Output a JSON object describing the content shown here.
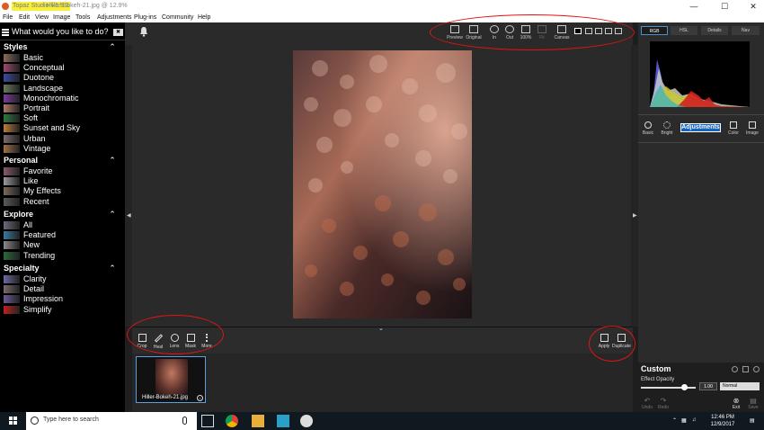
{
  "window": {
    "title_highlight": "Topaz Studio V1.5.3",
    "title_rest": "- Hiller-Bokeh-21.jpg @ 12.9%",
    "minimize": "—",
    "maximize": "☐",
    "close": "✕"
  },
  "menu": [
    "File",
    "Edit",
    "View",
    "Image",
    "Tools",
    "Adjustments",
    "Plug-ins",
    "Community",
    "Help"
  ],
  "sidebar": {
    "search_placeholder": "What would you like to do?",
    "clear_label": "✖",
    "collapse_glyph": "⌃",
    "sections": [
      {
        "title": "Styles",
        "items": [
          {
            "label": "Basic",
            "color": "#8a6a5a"
          },
          {
            "label": "Conceptual",
            "color": "#9a4a6a"
          },
          {
            "label": "Duotone",
            "color": "#3a4aa0"
          },
          {
            "label": "Landscape",
            "color": "#6a7a5a"
          },
          {
            "label": "Monochromatic",
            "color": "#7a3aa0"
          },
          {
            "label": "Portrait",
            "color": "#b07a6a"
          },
          {
            "label": "Soft",
            "color": "#2a7a3a"
          },
          {
            "label": "Sunset and Sky",
            "color": "#c07a3a"
          },
          {
            "label": "Urban",
            "color": "#7a6a6a"
          },
          {
            "label": "Vintage",
            "color": "#a0704a"
          }
        ]
      },
      {
        "title": "Personal",
        "items": [
          {
            "label": "Favorite",
            "color": "#8a5a6a"
          },
          {
            "label": "Like",
            "color": "#9a9aa0"
          },
          {
            "label": "My Effects",
            "color": "#7a6a5a"
          },
          {
            "label": "Recent",
            "color": "#5a5a5a"
          }
        ]
      },
      {
        "title": "Explore",
        "items": [
          {
            "label": "All",
            "color": "#6a6a7a"
          },
          {
            "label": "Featured",
            "color": "#3a7aa0"
          },
          {
            "label": "New",
            "color": "#8a8a8a"
          },
          {
            "label": "Trending",
            "color": "#2a6a3a"
          }
        ]
      },
      {
        "title": "Specialty",
        "items": [
          {
            "label": "Clarity",
            "color": "#6a6aa0"
          },
          {
            "label": "Detail",
            "color": "#7a6a6a"
          },
          {
            "label": "Impression",
            "color": "#6a5a9a"
          },
          {
            "label": "Simplify",
            "color": "#c02020"
          }
        ]
      }
    ]
  },
  "toolbar": {
    "buttons": [
      "Preview",
      "Original",
      "In",
      "Out",
      "100%",
      "Fit",
      "Canvas"
    ]
  },
  "bottom_tools": {
    "left": [
      "Crop",
      "Heal",
      "Lens",
      "Mask",
      "More"
    ],
    "right": [
      "Apply",
      "Duplicate"
    ]
  },
  "filmstrip": {
    "file_name": "Hiller-Bokeh-21.jpg"
  },
  "right_panel": {
    "tabs": [
      "RGB",
      "HSL",
      "Details",
      "Nav"
    ],
    "tools": [
      "Basic",
      "Bright",
      "Adjustments",
      "Color",
      "Image"
    ],
    "custom_title": "Custom",
    "opacity_label": "Effect Opacity",
    "opacity_value": "1.00",
    "blend_mode": "Normal",
    "footer": [
      "Undo",
      "Redo",
      "Exit",
      "Save"
    ]
  },
  "taskbar": {
    "search_placeholder": "Type here to search",
    "time": "12:46 PM",
    "date": "12/9/2017"
  },
  "colors": {
    "annotation": "#e01515",
    "title_highlight": "#f7f03a",
    "accent": "#1565c0"
  }
}
